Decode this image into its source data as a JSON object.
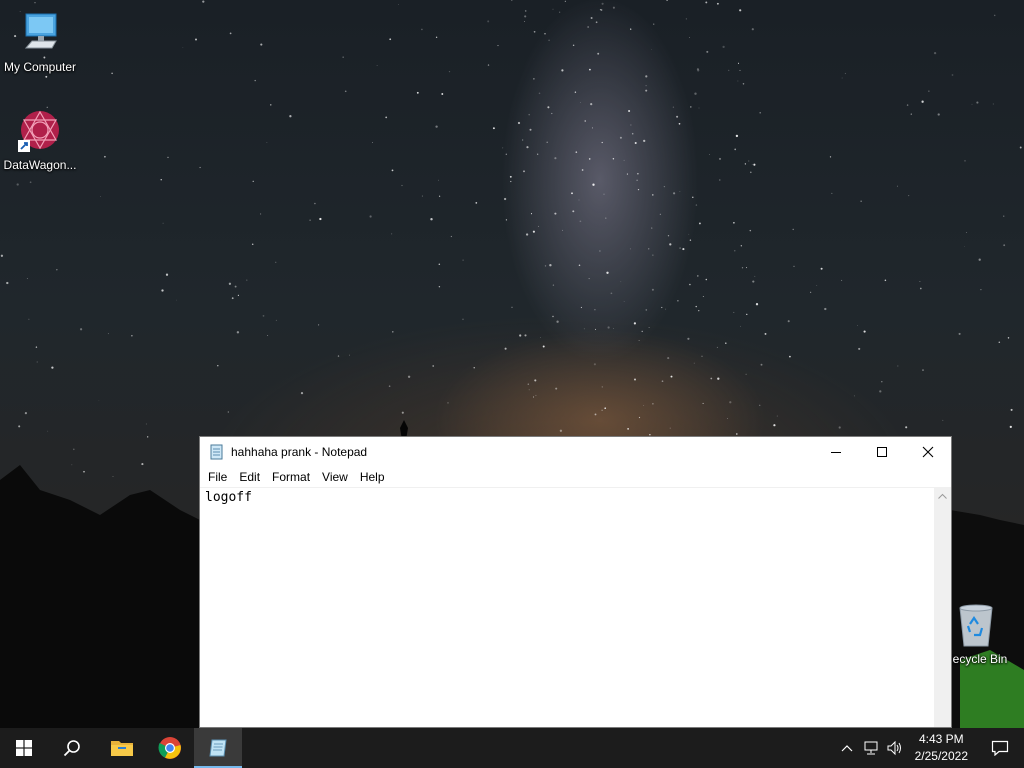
{
  "desktop": {
    "icons": [
      {
        "label": "My Computer",
        "icon": "computer-icon"
      },
      {
        "label": "DataWagon...",
        "icon": "datawagon-icon"
      },
      {
        "label": "Recycle Bin",
        "icon": "recycle-bin-icon"
      }
    ]
  },
  "notepad": {
    "title": "hahhaha prank - Notepad",
    "menu": [
      "File",
      "Edit",
      "Format",
      "View",
      "Help"
    ],
    "content": "logoff"
  },
  "taskbar": {
    "pinned": [
      "start-icon",
      "search-icon",
      "file-explorer-icon",
      "chrome-icon",
      "notepad-icon"
    ],
    "active": "notepad-icon",
    "clock": {
      "time": "4:43 PM",
      "date": "2/25/2022"
    }
  },
  "colors": {
    "taskbar_bg": "#1c1c1c",
    "active_indicator": "#76b9ed",
    "window_bg": "#ffffff"
  }
}
